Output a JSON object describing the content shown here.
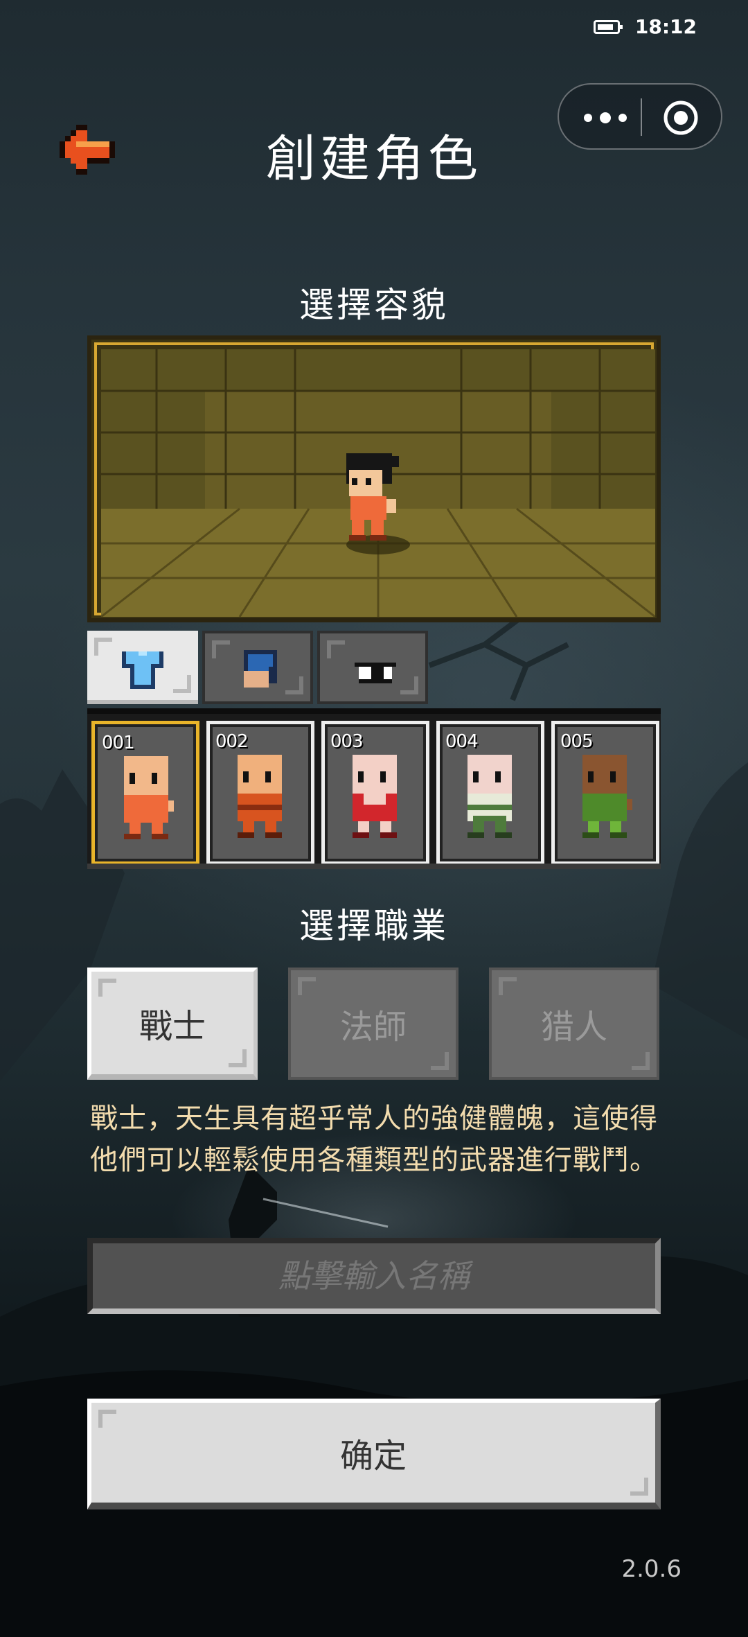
{
  "status_bar": {
    "time": "18:12"
  },
  "header": {
    "title": "創建角色"
  },
  "appearance": {
    "section_title": "選擇容貌",
    "category_tabs": [
      {
        "icon": "shirt-icon",
        "active": true
      },
      {
        "icon": "hair-icon",
        "active": false
      },
      {
        "icon": "eye-icon",
        "active": false
      }
    ],
    "items": [
      {
        "number": "001",
        "selected": true
      },
      {
        "number": "002",
        "selected": false
      },
      {
        "number": "003",
        "selected": false
      },
      {
        "number": "004",
        "selected": false
      },
      {
        "number": "005",
        "selected": false
      }
    ]
  },
  "profession": {
    "section_title": "選擇職業",
    "classes": [
      {
        "label": "戰士",
        "active": true
      },
      {
        "label": "法師",
        "active": false
      },
      {
        "label": "猎人",
        "active": false
      }
    ],
    "description_line1": "戰士，天生具有超乎常人的強健體魄，這使得",
    "description_line2": "他們可以輕鬆使用各種類型的武器進行戰鬥。"
  },
  "name_input": {
    "placeholder": "點擊輸入名稱",
    "value": ""
  },
  "confirm_label": "确定",
  "version": "2.0.6",
  "colors": {
    "accent_gold": "#e9b42a",
    "description_text": "#f3dcae",
    "back_arrow": "#e8501e"
  }
}
